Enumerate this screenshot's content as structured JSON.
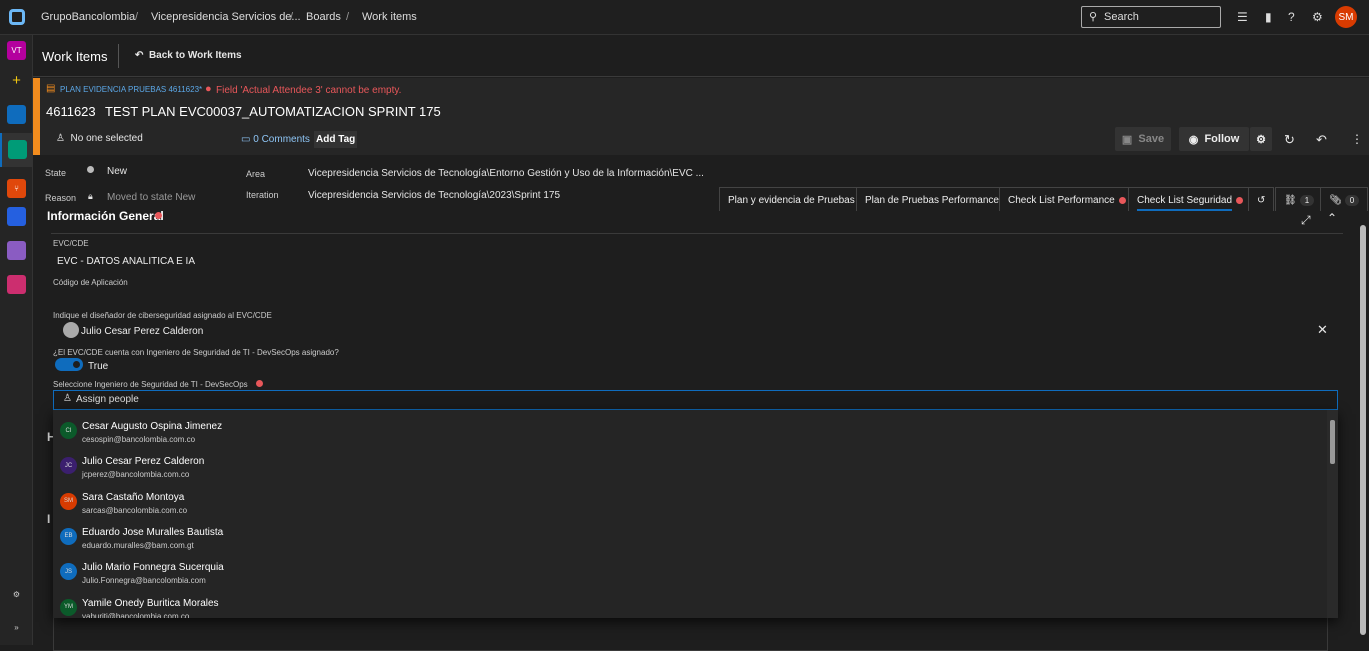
{
  "topbar": {
    "org": "GrupoBancolombia",
    "project": "Vicepresidencia Servicios de...",
    "boards": "Boards",
    "work_items": "Work items",
    "search_placeholder": "Search",
    "user_initials": "SM"
  },
  "sidebar": {
    "project_initials": "VT"
  },
  "header": {
    "title": "Work Items",
    "back_label": "Back to Work Items"
  },
  "work_item": {
    "type_label": "PLAN EVIDENCIA PRUEBAS 4611623*",
    "error": "Field 'Actual Attendee 3' cannot be empty.",
    "id": "4611623",
    "title": "TEST PLAN EVC00037_AUTOMATIZACION SPRINT 175",
    "assignee": "No one selected",
    "comments": "0 Comments",
    "add_tag": "Add Tag",
    "save": "Save",
    "follow": "Follow"
  },
  "fields": {
    "state_label": "State",
    "state": "New",
    "reason_label": "Reason",
    "reason": "Moved to state New",
    "area_label": "Area",
    "area": "Vicepresidencia Servicios de Tecnología\\Entorno Gestión y Uso de la Información\\EVC ...",
    "iteration_label": "Iteration",
    "iteration": "Vicepresidencia Servicios de Tecnología\\2023\\Sprint 175"
  },
  "tabs": [
    {
      "label": "Plan y evidencia de Pruebas"
    },
    {
      "label": "Plan de Pruebas Performance"
    },
    {
      "label": "Check List Performance"
    },
    {
      "label": "Check List Seguridad"
    }
  ],
  "counts": {
    "links": "1",
    "attachments": "0"
  },
  "form": {
    "section": "Información General",
    "evc_label": "EVC/CDE",
    "evc_value": "EVC - DATOS ANALITICA E IA",
    "codigo_label": "Código de Aplicación",
    "disenador_label": "Indique el diseñador de ciberseguridad asignado al EVC/CDE",
    "disenador_value": "Julio Cesar Perez Calderon",
    "devsecops_q": "¿El EVC/CDE cuenta con Ingeniero de Seguridad de TI - DevSecOps asignado?",
    "toggle_value": "True",
    "toggle_on": true,
    "select_label": "Seleccione Ingeniero de Seguridad de TI - DevSecOps",
    "assign_placeholder": "Assign people",
    "hidden_h": "H",
    "hidden_i": "I"
  },
  "people": [
    {
      "initials": "CI",
      "name": "Cesar Augusto Ospina Jimenez",
      "email": "cesospin@bancolombia.com.co",
      "color": "#0b5a2a"
    },
    {
      "initials": "JC",
      "name": "Julio Cesar Perez Calderon",
      "email": "jcperez@bancolombia.com.co",
      "color": "#3b1f6e"
    },
    {
      "initials": "SM",
      "name": "Sara Castaño Montoya",
      "email": "sarcas@bancolombia.com.co",
      "color": "#d83b01"
    },
    {
      "initials": "EB",
      "name": "Eduardo Jose Muralles Bautista",
      "email": "eduardo.muralles@bam.com.gt",
      "color": "#0f6cbd"
    },
    {
      "initials": "JS",
      "name": "Julio Mario Fonnegra Sucerquia",
      "email": "Julio.Fonnegra@bancolombia.com",
      "color": "#0f6cbd"
    },
    {
      "initials": "YM",
      "name": "Yamile Onedy Buritica Morales",
      "email": "yaburiti@bancolombia.com.co",
      "color": "#0b5a2a"
    }
  ]
}
